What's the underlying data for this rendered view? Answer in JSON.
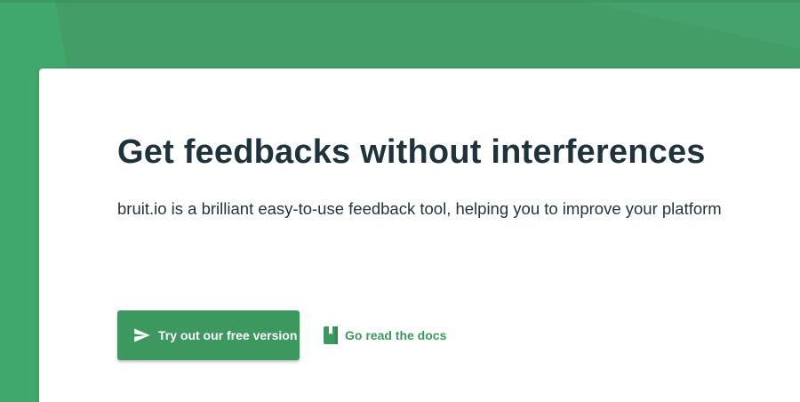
{
  "colors": {
    "page_green": "#3fa86a",
    "accent_green": "#3d985f",
    "heading_text": "#1f333c",
    "body_text": "#23343c",
    "card_background": "#ffffff"
  },
  "hero": {
    "title": "Get feedbacks without interferences",
    "subtitle": "bruit.io is a brilliant easy-to-use feedback tool, helping you to improve your platform"
  },
  "actions": {
    "primary_label": "Try out our free version",
    "primary_icon": "send-icon",
    "secondary_label": "Go read the docs",
    "secondary_icon": "book-icon"
  }
}
